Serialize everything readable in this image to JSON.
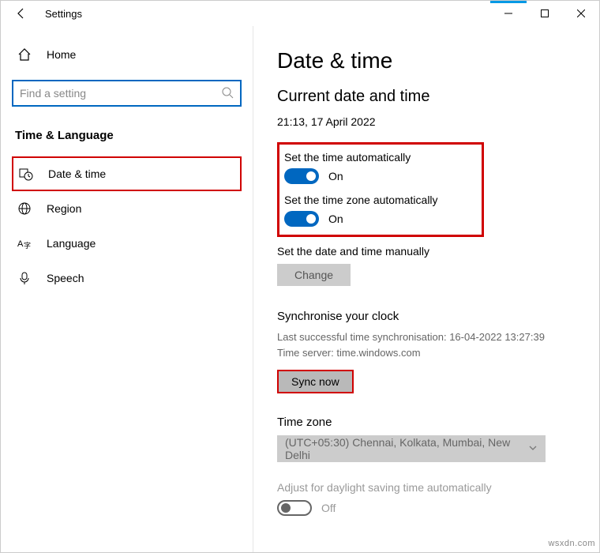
{
  "window": {
    "title": "Settings"
  },
  "sidebar": {
    "home": "Home",
    "search_placeholder": "Find a setting",
    "category": "Time & Language",
    "items": [
      {
        "label": "Date & time"
      },
      {
        "label": "Region"
      },
      {
        "label": "Language"
      },
      {
        "label": "Speech"
      }
    ]
  },
  "content": {
    "page_title": "Date & time",
    "section_title": "Current date and time",
    "current_datetime": "21:13, 17 April 2022",
    "auto_time": {
      "label": "Set the time automatically",
      "state": "On"
    },
    "auto_tz": {
      "label": "Set the time zone automatically",
      "state": "On"
    },
    "manual": {
      "label": "Set the date and time manually",
      "button": "Change"
    },
    "sync": {
      "title": "Synchronise your clock",
      "last_sync": "Last successful time synchronisation: 16-04-2022 13:27:39",
      "server": "Time server: time.windows.com",
      "button": "Sync now"
    },
    "timezone": {
      "title": "Time zone",
      "value": "(UTC+05:30) Chennai, Kolkata, Mumbai, New Delhi"
    },
    "dst": {
      "label": "Adjust for daylight saving time automatically",
      "state": "Off"
    }
  },
  "watermark": "wsxdn.com"
}
